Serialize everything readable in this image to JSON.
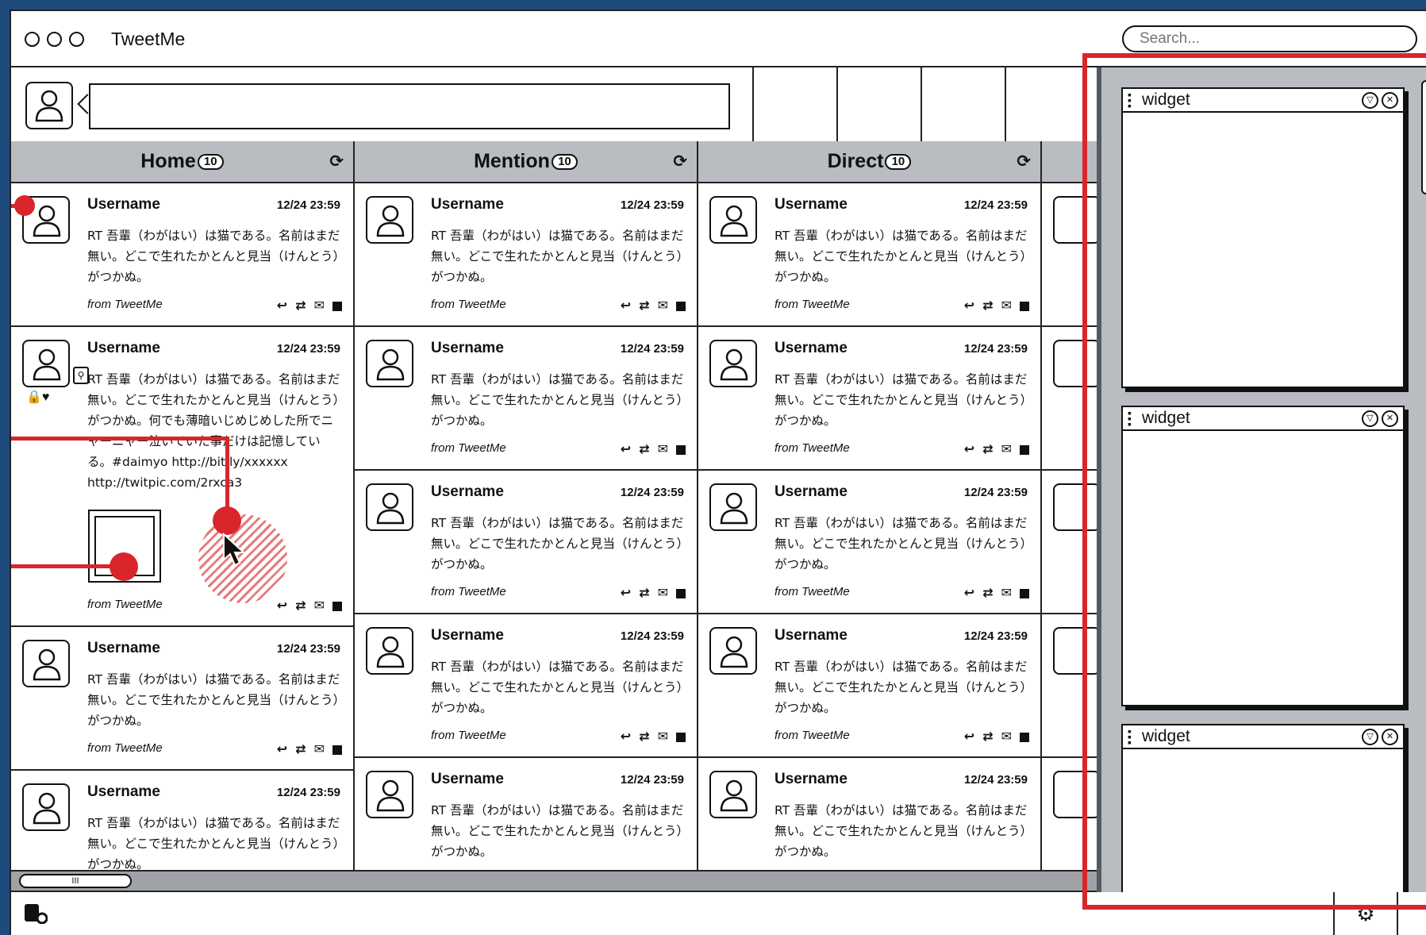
{
  "window": {
    "title": "TweetMe"
  },
  "search": {
    "placeholder": "Search..."
  },
  "columns": [
    {
      "title": "Home",
      "count": "10",
      "refresh_icon": "refresh-icon"
    },
    {
      "title": "Mention",
      "count": "10",
      "refresh_icon": "refresh-icon"
    },
    {
      "title": "Direct",
      "count": "10",
      "refresh_icon": "refresh-icon"
    }
  ],
  "tweet": {
    "username": "Username",
    "time": "12/24 23:59",
    "text": "RT 吾輩（わがはい）は猫である。名前はまだ無い。どこで生れたかとんと見当（けんとう）がつかぬ。",
    "long_text": "RT 吾輩（わがはい）は猫である。名前はまだ無い。どこで生れたかとんと見当（けんとう）がつかぬ。何でも薄暗いじめじめした所でニャーニャー泣いていた事だけは記憶している。#daimyo http://bit.ly/xxxxxx http://twitpic.com/2rxca3",
    "source": "from TweetMe"
  },
  "actions": {
    "reply": "↩",
    "retweet": "⇄",
    "mail": "✉",
    "more": ""
  },
  "widgets": [
    {
      "title": "widget"
    },
    {
      "title": "widget"
    },
    {
      "title": "widget"
    }
  ],
  "scrollbar": {
    "thumb_label": "III"
  },
  "colors": {
    "accent": "#d9262d",
    "header_bg": "#b9bcc1",
    "frame_bg": "#1f4a7c"
  }
}
